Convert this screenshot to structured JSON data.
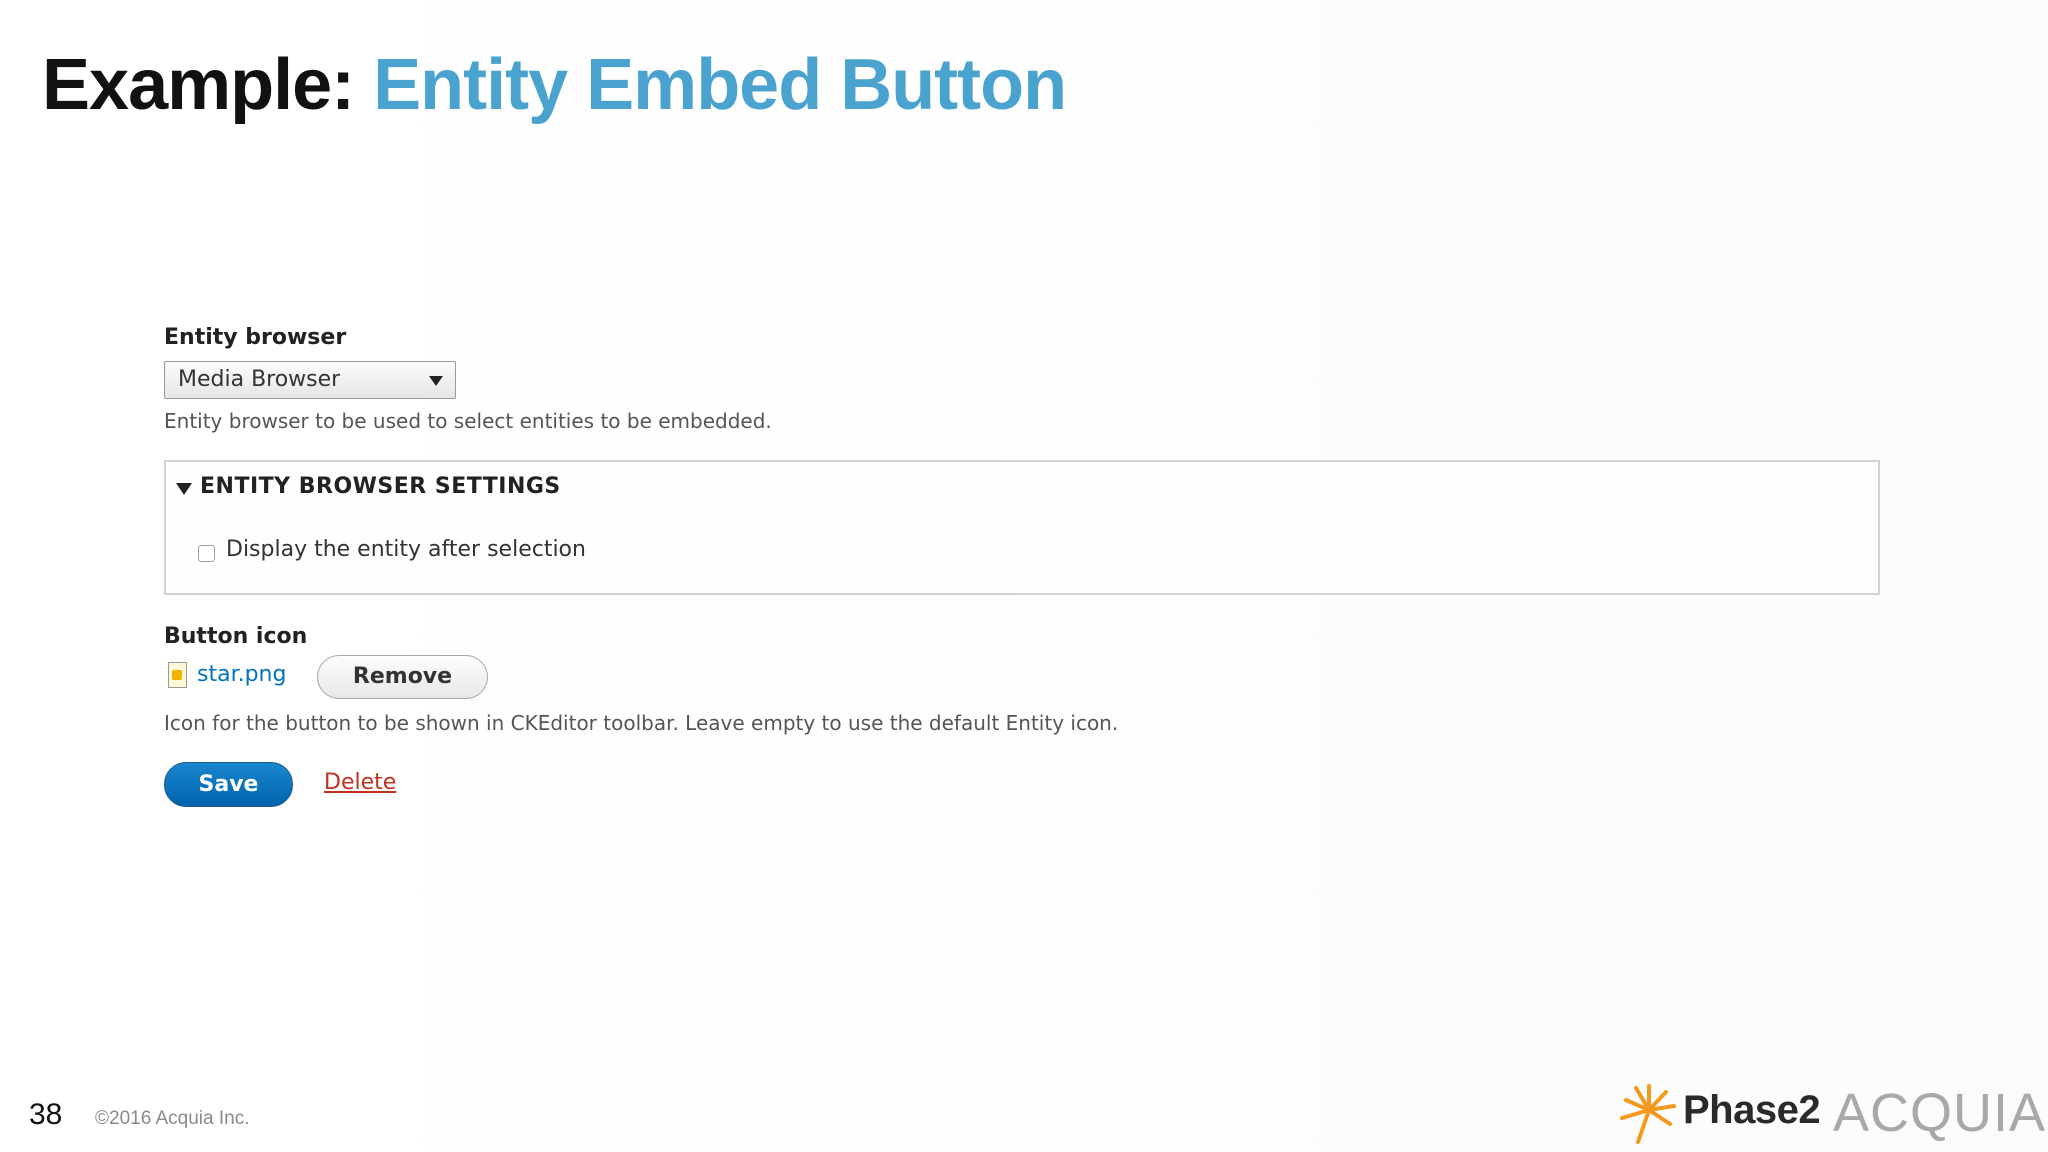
{
  "slide": {
    "title_prefix": "Example: ",
    "title_highlight": "Entity Embed Button",
    "page_number": "38",
    "copyright": "©2016 Acquia Inc.",
    "logos": {
      "phase2": "Phase2",
      "acquia": "ACQUIA"
    }
  },
  "form": {
    "entity_browser": {
      "label": "Entity browser",
      "selected": "Media Browser",
      "description": "Entity browser to be used to select entities to be embedded."
    },
    "settings": {
      "legend": "ENTITY BROWSER SETTINGS",
      "expanded": true,
      "checkbox_label": "Display the entity after selection",
      "checked": false
    },
    "button_icon": {
      "label": "Button icon",
      "file_name": "star.png",
      "remove_label": "Remove",
      "description": "Icon for the button to be shown in CKEditor toolbar. Leave empty to use the default Entity icon."
    },
    "actions": {
      "save_label": "Save",
      "delete_label": "Delete"
    }
  },
  "colors": {
    "title_accent": "#4aa3cf",
    "save_button": "#0063ac",
    "link": "#0074bd",
    "delete_link": "#c0311f",
    "phase2_orange": "#f39a1e"
  }
}
